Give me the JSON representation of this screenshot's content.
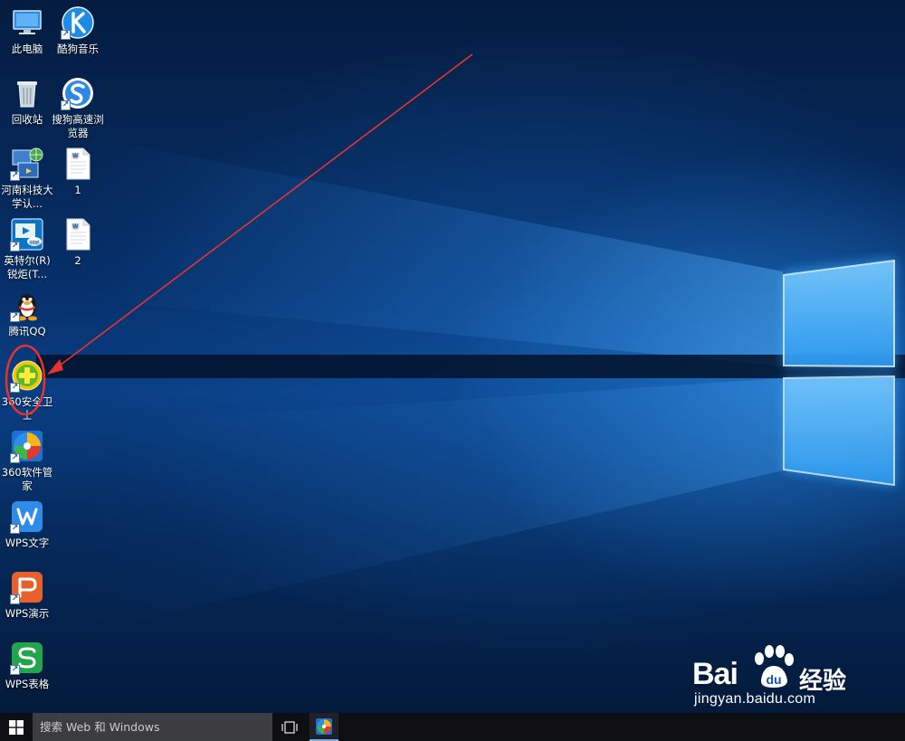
{
  "desktop": {
    "icons": [
      {
        "id": "this-pc",
        "label": "此电脑",
        "shortcut": false
      },
      {
        "id": "kugou-music",
        "label": "酷狗音乐",
        "shortcut": true
      },
      {
        "id": "recycle-bin",
        "label": "回收站",
        "shortcut": false
      },
      {
        "id": "sogou-browser",
        "label": "搜狗高速浏览器",
        "shortcut": true
      },
      {
        "id": "henan-univ-auth",
        "label": "河南科技大学认...",
        "shortcut": true
      },
      {
        "id": "doc-1",
        "label": "1",
        "shortcut": false
      },
      {
        "id": "intel-rapid",
        "label": "英特尔(R) 锐炬(T...",
        "shortcut": true
      },
      {
        "id": "doc-2",
        "label": "2",
        "shortcut": false
      },
      {
        "id": "tencent-qq",
        "label": "腾讯QQ",
        "shortcut": true
      },
      {
        "id": "360-safe",
        "label": "360安全卫士",
        "shortcut": true
      },
      {
        "id": "360-soft",
        "label": "360软件管家",
        "shortcut": true
      },
      {
        "id": "wps-writer",
        "label": "WPS文字",
        "shortcut": true
      },
      {
        "id": "wps-presentation",
        "label": "WPS演示",
        "shortcut": true
      },
      {
        "id": "wps-spreadsheet",
        "label": "WPS表格",
        "shortcut": true
      }
    ]
  },
  "taskbar": {
    "search_placeholder": "搜索 Web 和 Windows",
    "icons": [
      "windows-start-icon",
      "task-view-icon",
      "360-soft-icon"
    ]
  },
  "annotation": {
    "color": "#e8322f"
  },
  "watermark": {
    "brand": "Bai",
    "cn": "经验",
    "url": "jingyan.baidu.com"
  },
  "colors": {
    "taskbar": "#0e0f12",
    "search_box": "#3b3d41",
    "wallpaper_glow": "#2e8fe6"
  }
}
